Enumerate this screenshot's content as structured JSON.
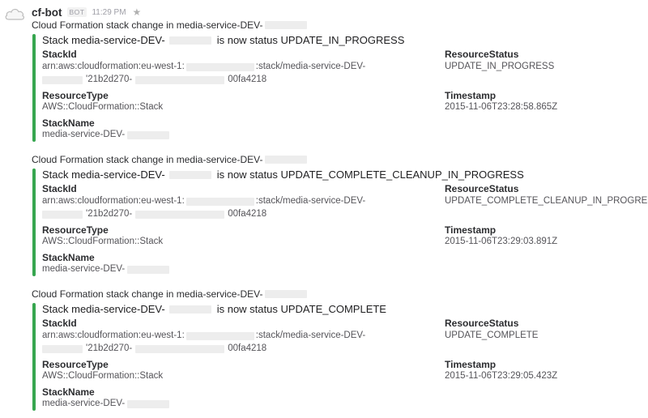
{
  "message": {
    "bot_name": "cf-bot",
    "badge": "BOT",
    "time": "11:29 PM"
  },
  "events": [
    {
      "intro": "Cloud Formation stack change in media-service-DEV-",
      "title_prefix": "Stack media-service-DEV-",
      "title_suffix": "is now status UPDATE_IN_PROGRESS",
      "stack_id_label": "StackId",
      "stack_id_line1_a": "arn:aws:cloudformation:eu-west-1:",
      "stack_id_line1_b": ":stack/media-service-DEV-",
      "stack_id_line2_a": "'21b2d270-",
      "stack_id_line2_b": "00fa4218",
      "resource_status_label": "ResourceStatus",
      "resource_status": "UPDATE_IN_PROGRESS",
      "resource_type_label": "ResourceType",
      "resource_type": "AWS::CloudFormation::Stack",
      "timestamp_label": "Timestamp",
      "timestamp": "2015-11-06T23:28:58.865Z",
      "stack_name_label": "StackName",
      "stack_name": "media-service-DEV-"
    },
    {
      "intro": "Cloud Formation stack change in media-service-DEV-",
      "title_prefix": "Stack media-service-DEV-",
      "title_suffix": "is now status UPDATE_COMPLETE_CLEANUP_IN_PROGRESS",
      "stack_id_label": "StackId",
      "stack_id_line1_a": "arn:aws:cloudformation:eu-west-1:",
      "stack_id_line1_b": ":stack/media-service-DEV-",
      "stack_id_line2_a": "'21b2d270-",
      "stack_id_line2_b": "00fa4218",
      "resource_status_label": "ResourceStatus",
      "resource_status": "UPDATE_COMPLETE_CLEANUP_IN_PROGRESS",
      "resource_type_label": "ResourceType",
      "resource_type": "AWS::CloudFormation::Stack",
      "timestamp_label": "Timestamp",
      "timestamp": "2015-11-06T23:29:03.891Z",
      "stack_name_label": "StackName",
      "stack_name": "media-service-DEV-"
    },
    {
      "intro": "Cloud Formation stack change in media-service-DEV-",
      "title_prefix": "Stack media-service-DEV-",
      "title_suffix": "is now status UPDATE_COMPLETE",
      "stack_id_label": "StackId",
      "stack_id_line1_a": "arn:aws:cloudformation:eu-west-1:",
      "stack_id_line1_b": ":stack/media-service-DEV-",
      "stack_id_line2_a": "'21b2d270-",
      "stack_id_line2_b": "00fa4218",
      "resource_status_label": "ResourceStatus",
      "resource_status": "UPDATE_COMPLETE",
      "resource_type_label": "ResourceType",
      "resource_type": "AWS::CloudFormation::Stack",
      "timestamp_label": "Timestamp",
      "timestamp": "2015-11-06T23:29:05.423Z",
      "stack_name_label": "StackName",
      "stack_name": "media-service-DEV-"
    }
  ],
  "icons": {
    "avatar": "cloud-icon",
    "star": "star-icon"
  },
  "colors": {
    "attachment_bar": "#36a64f",
    "redaction": "#ededed"
  }
}
